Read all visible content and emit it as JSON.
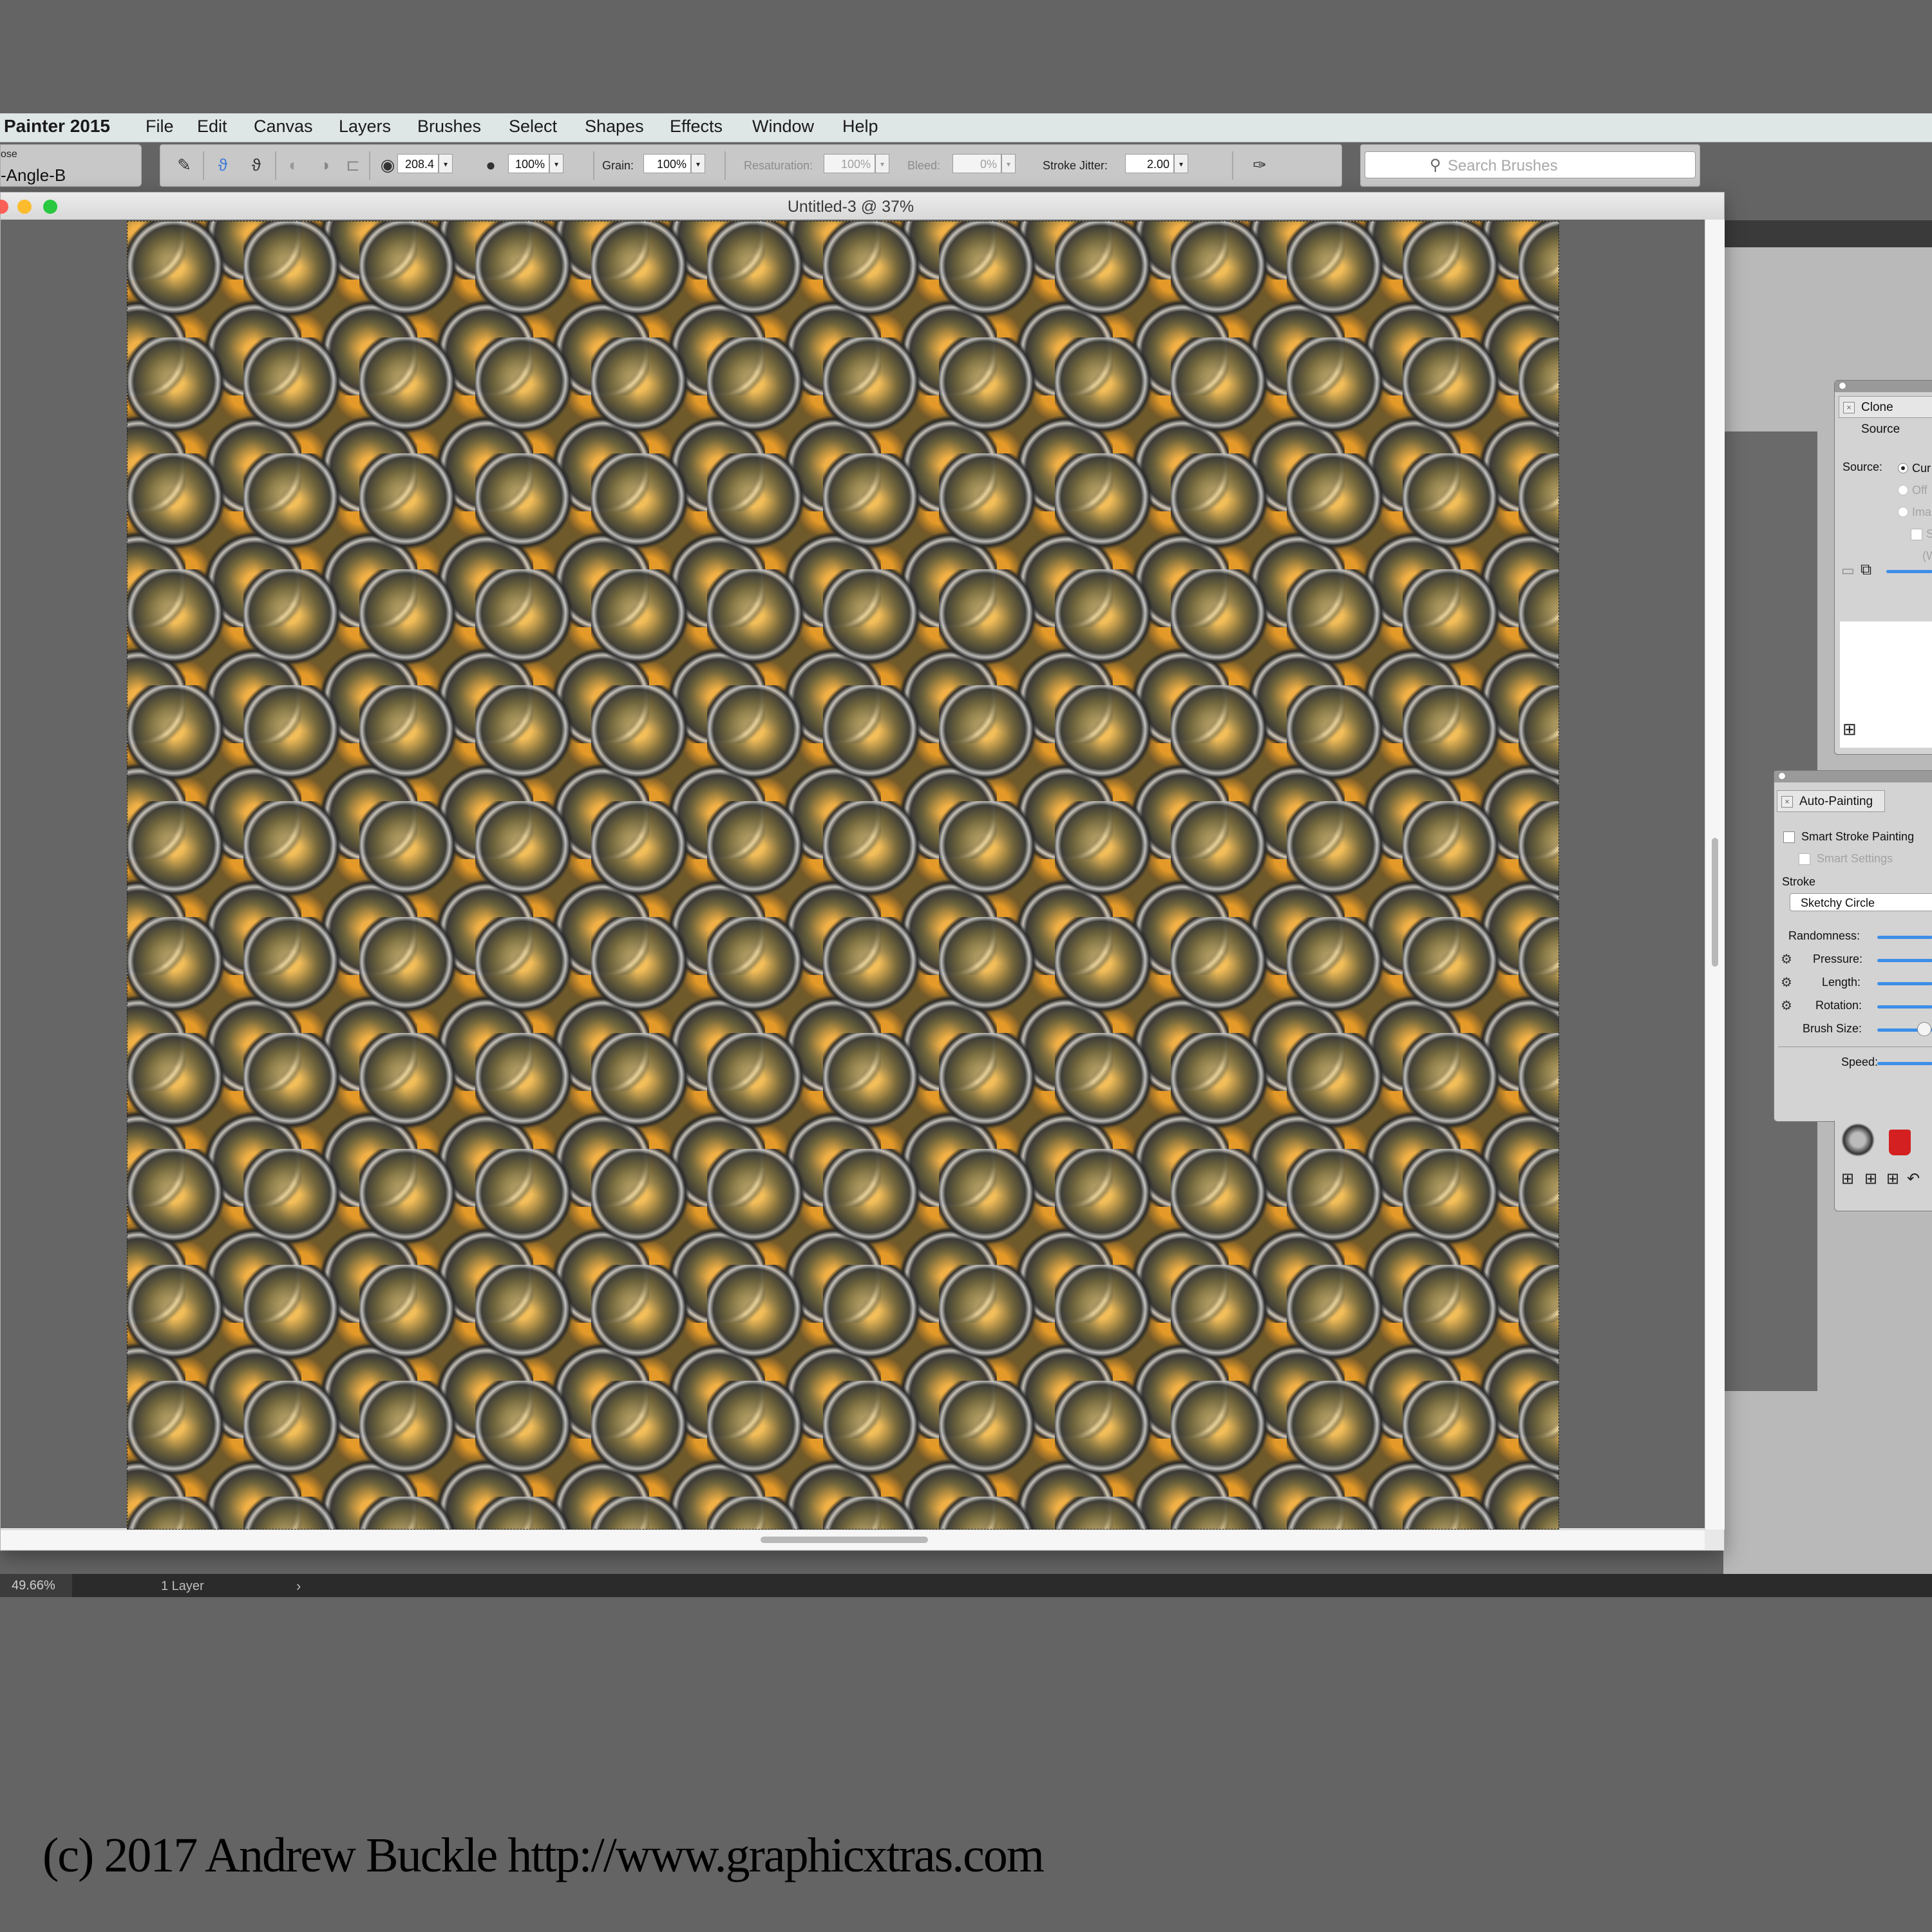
{
  "app": {
    "name": "Painter 2015"
  },
  "menu": [
    "File",
    "Edit",
    "Canvas",
    "Layers",
    "Brushes",
    "Select",
    "Shapes",
    "Effects",
    "Window",
    "Help"
  ],
  "brush_selector": {
    "category": "ose",
    "variant": "-Angle-B"
  },
  "property_bar": {
    "size_value": "208.4",
    "opacity_value": "100%",
    "grain_label": "Grain:",
    "grain_value": "100%",
    "resaturation_label": "Resaturation:",
    "resaturation_value": "100%",
    "bleed_label": "Bleed:",
    "bleed_value": "0%",
    "stroke_jitter_label": "Stroke Jitter:",
    "stroke_jitter_value": "2.00"
  },
  "search": {
    "placeholder": "Search Brushes"
  },
  "document": {
    "title": "Untitled-3 @ 37%"
  },
  "status_bar": {
    "zoom": "49.66%",
    "layers": "1 Layer"
  },
  "clone_source_panel": {
    "title": "Clone Source",
    "source_label": "Source:",
    "options": [
      "Cur",
      "Off",
      "Ima"
    ],
    "extra": [
      "S",
      "(W"
    ]
  },
  "auto_painting_panel": {
    "title": "Auto-Painting",
    "smart_stroke_painting": "Smart Stroke Painting",
    "smart_settings": "Smart Settings",
    "stroke_label": "Stroke",
    "stroke_value": "Sketchy Circle",
    "sliders": [
      {
        "label": "Randomness:",
        "value": 0.5
      },
      {
        "label": "Pressure:",
        "value": 0.5
      },
      {
        "label": "Length:",
        "value": 0.5
      },
      {
        "label": "Rotation:",
        "value": 0.5
      },
      {
        "label": "Brush Size:",
        "value": 0.3
      },
      {
        "label": "Speed:",
        "value": 0.5
      }
    ]
  },
  "colors": {
    "slider_blue": "#3d8ee8",
    "menubar": "#dfe6e6",
    "close": "#fc5f57",
    "minimize": "#fdbc2e",
    "zoom": "#29c840"
  },
  "copyright": "(c) 2017 Andrew Buckle http://www.graphicxtras.com"
}
